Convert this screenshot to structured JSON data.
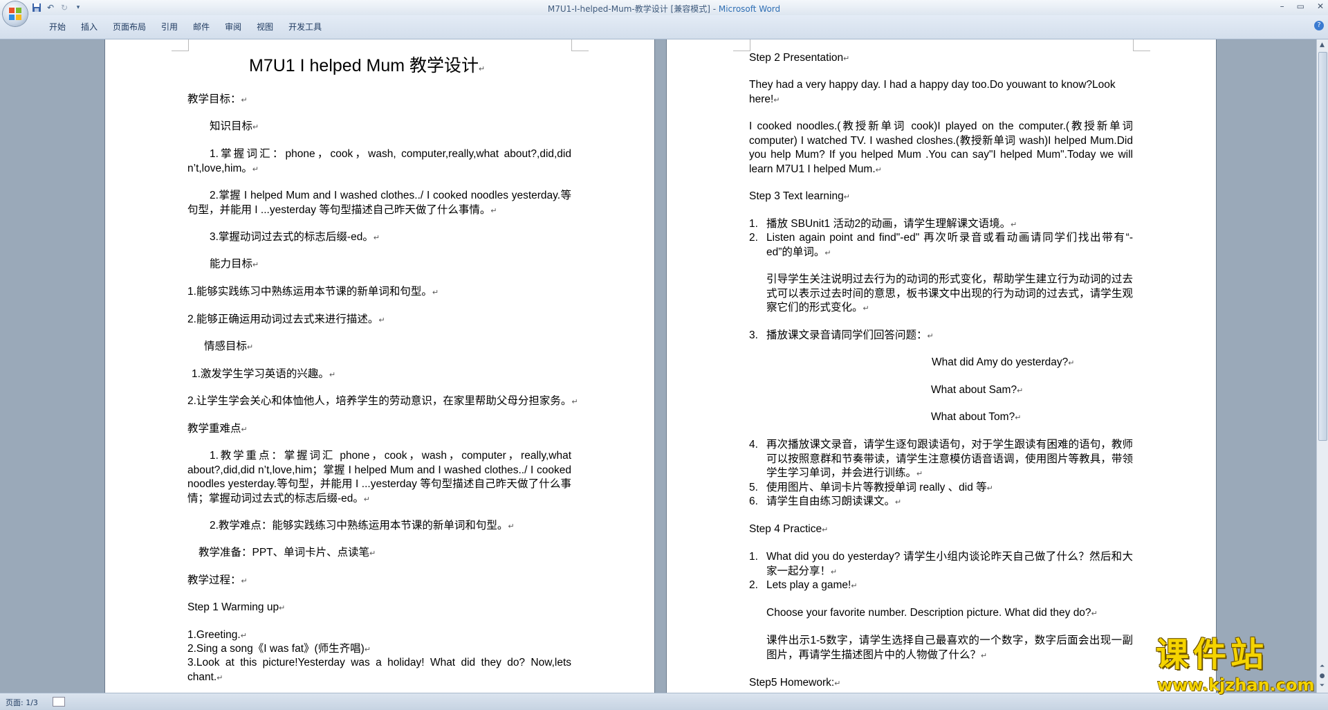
{
  "window": {
    "title": "M7U1-I-helped-Mum-教学设计 [兼容模式] - ",
    "app_name": "Microsoft Word"
  },
  "quick_access": {
    "save_icon": "save-icon",
    "undo_icon": "undo-icon",
    "redo_icon": "redo-icon",
    "customize_icon": "dropdown-icon"
  },
  "ribbon": {
    "tabs": [
      "开始",
      "插入",
      "页面布局",
      "引用",
      "邮件",
      "审阅",
      "视图",
      "开发工具"
    ]
  },
  "page1": {
    "title": "M7U1 I helped Mum  教学设计",
    "lines": [
      "教学目标：",
      "知识目标",
      "1.掌握词汇：phone，cook，wash, computer,really,what about?,did,did n’t,love,him。",
      "2.掌握 I helped Mum and I washed clothes../ I cooked noodles yesterday.等句型，并能用 I ...yesterday  等句型描述自己昨天做了什么事情。",
      "3.掌握动词过去式的标志后缀-ed。",
      "能力目标",
      "1.能够实践练习中熟练运用本节课的新单词和句型。",
      "2.能够正确运用动词过去式来进行描述。",
      "情感目标",
      "1.激发学生学习英语的兴趣。",
      "2.让学生学会关心和体恤他人，培养学生的劳动意识，在家里帮助父母分担家务。",
      "教学重难点",
      "1.教学重点：掌握词汇 phone，cook，wash，computer，really,what about?,did,did n’t,love,him；掌握 I helped Mum and I washed clothes../ I cooked noodles yesterday.等句型，并能用 I ...yesterday 等句型描述自己昨天做了什么事情；掌握动词过去式的标志后缀-ed。",
      "2.教学难点：能够实践练习中熟练运用本节课的新单词和句型。",
      "教学准备：PPT、单词卡片、点读笔",
      "教学过程：",
      "Step 1 Warming up",
      "1.Greeting.",
      "2.Sing a song《I was fat》(师生齐唱)",
      "3.Look at this picture!Yesterday was a holiday! What did they do? Now,lets chant."
    ]
  },
  "page2": {
    "lines": [
      "Step 2 Presentation",
      "They had a very happy day. I had a happy day too.Do youwant to know?Look here!",
      "I cooked noodles.(教授新单词 cook)I played on the computer.(教授新单词computer) I watched TV. I washed closhes.(教授新单词 wash)I helped Mum.Did you help Mum? If you helped Mum .You can say\"I helped Mum\".Today we will learn M7U1    I helped Mum.",
      "Step 3 Text learning",
      "播放 SBUnit1 活动2的动画，请学生理解课文语境。",
      "Listen again point and find\"-ed\" 再次听录音或看动画请同学们找出带有“-ed”的单词。",
      "引导学生关注说明过去行为的动词的形式变化，帮助学生建立行为动词的过去式可以表示过去时间的意思，板书课文中出现的行为动词的过去式，请学生观察它们的形式变化。",
      "播放课文录音请同学们回答问题：",
      "What did Amy do yesterday?",
      "What about Sam?",
      "What about Tom?",
      "再次播放课文录音，请学生逐句跟读语句，对于学生跟读有困难的语句，教师可以按照意群和节奏带读，请学生注意模仿语音语调，使用图片等教具，带领学生学习单词，并会进行训练。",
      "使用图片、单词卡片等教授单词 really 、did 等",
      "请学生自由练习朗读课文。",
      "Step 4 Practice",
      "What did you do yesterday? 请学生小组内谈论昨天自己做了什么？然后和大家一起分享！",
      "Lets play a game!",
      "Choose your favorite number. Description picture. What did they do?",
      "课件出示1-5数字，请学生选择自己最喜欢的一个数字，数字后面会出现一副图片，再请学生描述图片中的人物做了什么？",
      "Step5 Homework:"
    ],
    "list_numbers": [
      "1.",
      "2.",
      "3.",
      "4.",
      "5.",
      "6.",
      "1.",
      "2."
    ]
  },
  "status_bar": {
    "page_count": "页面: 1/3"
  },
  "watermark": {
    "main": "课件站",
    "sub": "www.kjzhan.com"
  },
  "colors": {
    "workspace": "#9aa9b9",
    "ribbon": "#d3deec",
    "app_name": "#2f6fb4",
    "watermark": "#f5d400"
  }
}
